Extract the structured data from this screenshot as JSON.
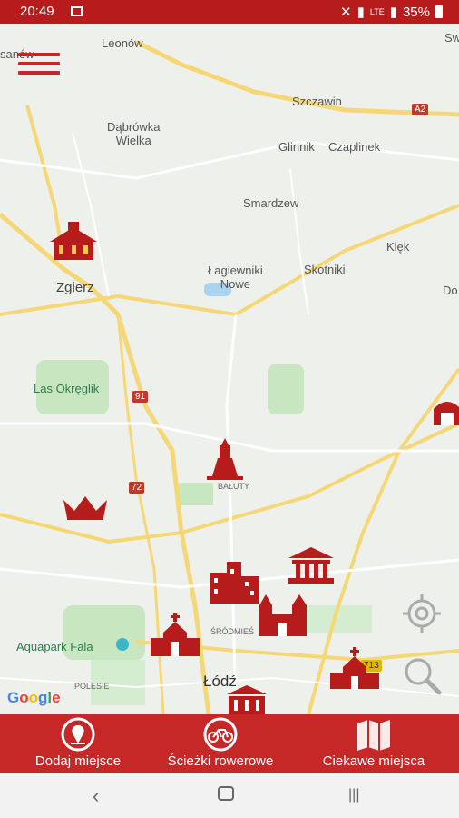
{
  "status": {
    "time": "20:49",
    "network": "LTE",
    "battery": "35%"
  },
  "map": {
    "labels": {
      "leonow": "Leonów",
      "dabrowka": "Dąbrówka\nWielka",
      "szczawin": "Szczawin",
      "glinnik": "Glinnik",
      "czaplinek": "Czaplinek",
      "smardzew": "Smardzew",
      "klek": "Klęk",
      "skotniki": "Skotniki",
      "lagiewniki": "Łagiewniki\nNowe",
      "zgierz": "Zgierz",
      "do": "Do",
      "okreglik": "Las Okręglik",
      "baluty": "BAŁUTY",
      "srodmiescie": "ŚRÓDMIEŚ",
      "aquapark": "Aquapark Fala",
      "polesie": "POLESIE",
      "lodz": "Łódź",
      "sanow": "sanów",
      "sw": "Sw"
    },
    "road_badges": {
      "a2": "A2",
      "r91": "91",
      "r72": "72",
      "r713": "713"
    },
    "google": [
      "G",
      "o",
      "o",
      "g",
      "l",
      "e"
    ]
  },
  "colors": {
    "brand": "#c62828",
    "status": "#b71c1c"
  },
  "bottom_nav": {
    "add_place": "Dodaj miejsce",
    "bike_paths": "Ścieżki rowerowe",
    "interesting_places": "Ciekawe miejsca"
  },
  "icons": {
    "menu": "hamburger-icon",
    "locate": "crosshair-icon",
    "search": "magnifier-icon"
  }
}
